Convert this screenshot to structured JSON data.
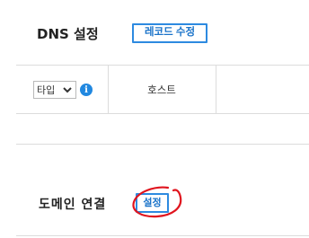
{
  "dns": {
    "title": "DNS 설정",
    "record_edit_label": "레코드 수정"
  },
  "table": {
    "type_select_value": "타입",
    "host_header": "호스트"
  },
  "domain": {
    "title": "도메인 연결",
    "setting_label": "설정"
  },
  "colors": {
    "accent": "#2d8ae0",
    "annotation": "#e0141e"
  },
  "icons": {
    "info": "info-icon",
    "select_arrow": "chevron-down-icon"
  }
}
